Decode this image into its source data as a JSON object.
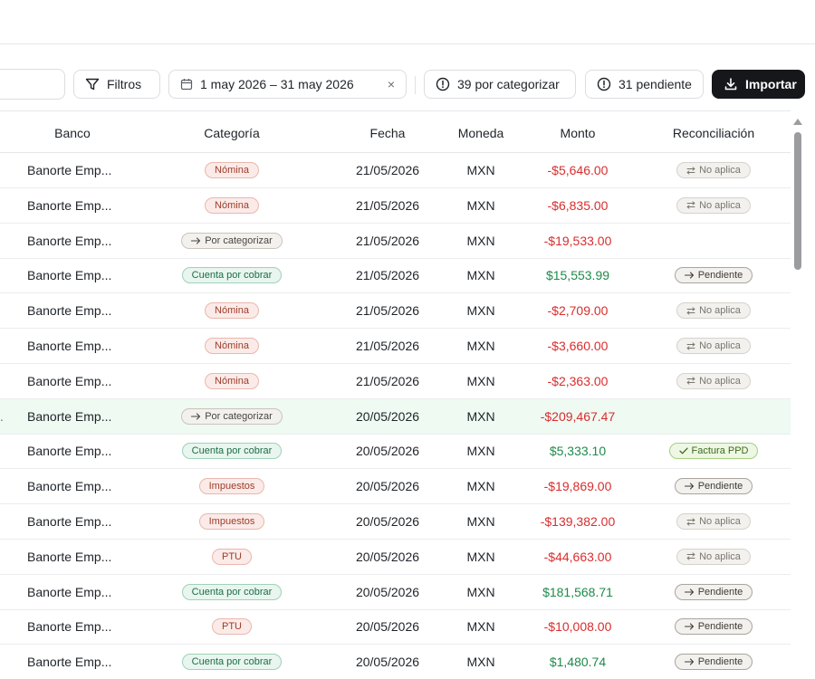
{
  "toolbar": {
    "filters_label": "Filtros",
    "date_range_label": "1 may 2026 – 31 may 2026",
    "clear_label": "×",
    "uncategorized_label": "39 por categorizar",
    "pending_label": "31 pendiente",
    "import_label": "Importar"
  },
  "table": {
    "headers": {
      "banco": "Banco",
      "categoria": "Categoría",
      "fecha": "Fecha",
      "moneda": "Moneda",
      "monto": "Monto",
      "reconciliacion": "Reconciliación"
    },
    "rows": [
      {
        "lead": "",
        "banco": "Banorte Emp...",
        "categoria": "Nómina",
        "cat_type": "nomina",
        "fecha": "21/05/2026",
        "moneda": "MXN",
        "monto": "-$5,646.00",
        "sign": "neg",
        "rec": "No aplica",
        "rec_type": "na"
      },
      {
        "lead": "",
        "banco": "Banorte Emp...",
        "categoria": "Nómina",
        "cat_type": "nomina",
        "fecha": "21/05/2026",
        "moneda": "MXN",
        "monto": "-$6,835.00",
        "sign": "neg",
        "rec": "No aplica",
        "rec_type": "na"
      },
      {
        "lead": "",
        "banco": "Banorte Emp...",
        "categoria": "Por categorizar",
        "cat_type": "cat",
        "fecha": "21/05/2026",
        "moneda": "MXN",
        "monto": "-$19,533.00",
        "sign": "neg",
        "rec": "",
        "rec_type": ""
      },
      {
        "lead": "",
        "banco": "Banorte Emp...",
        "categoria": "Cuenta por cobrar",
        "cat_type": "cxc",
        "fecha": "21/05/2026",
        "moneda": "MXN",
        "monto": "$15,553.99",
        "sign": "pos",
        "rec": "Pendiente",
        "rec_type": "pend"
      },
      {
        "lead": "",
        "banco": "Banorte Emp...",
        "categoria": "Nómina",
        "cat_type": "nomina",
        "fecha": "21/05/2026",
        "moneda": "MXN",
        "monto": "-$2,709.00",
        "sign": "neg",
        "rec": "No aplica",
        "rec_type": "na"
      },
      {
        "lead": "",
        "banco": "Banorte Emp...",
        "categoria": "Nómina",
        "cat_type": "nomina",
        "fecha": "21/05/2026",
        "moneda": "MXN",
        "monto": "-$3,660.00",
        "sign": "neg",
        "rec": "No aplica",
        "rec_type": "na"
      },
      {
        "lead": "",
        "banco": "Banorte Emp...",
        "categoria": "Nómina",
        "cat_type": "nomina",
        "fecha": "21/05/2026",
        "moneda": "MXN",
        "monto": "-$2,363.00",
        "sign": "neg",
        "rec": "No aplica",
        "rec_type": "na"
      },
      {
        "lead": ".",
        "banco": "Banorte Emp...",
        "categoria": "Por categorizar",
        "cat_type": "cat",
        "fecha": "20/05/2026",
        "moneda": "MXN",
        "monto": "-$209,467.47",
        "sign": "neg",
        "rec": "",
        "rec_type": "",
        "highlight": true
      },
      {
        "lead": "",
        "banco": "Banorte Emp...",
        "categoria": "Cuenta por cobrar",
        "cat_type": "cxc",
        "fecha": "20/05/2026",
        "moneda": "MXN",
        "monto": "$5,333.10",
        "sign": "pos",
        "rec": "Factura PPD",
        "rec_type": "ppd"
      },
      {
        "lead": "",
        "banco": "Banorte Emp...",
        "categoria": "Impuestos",
        "cat_type": "imp",
        "fecha": "20/05/2026",
        "moneda": "MXN",
        "monto": "-$19,869.00",
        "sign": "neg",
        "rec": "Pendiente",
        "rec_type": "pend"
      },
      {
        "lead": "",
        "banco": "Banorte Emp...",
        "categoria": "Impuestos",
        "cat_type": "imp",
        "fecha": "20/05/2026",
        "moneda": "MXN",
        "monto": "-$139,382.00",
        "sign": "neg",
        "rec": "No aplica",
        "rec_type": "na"
      },
      {
        "lead": "",
        "banco": "Banorte Emp...",
        "categoria": "PTU",
        "cat_type": "ptu",
        "fecha": "20/05/2026",
        "moneda": "MXN",
        "monto": "-$44,663.00",
        "sign": "neg",
        "rec": "No aplica",
        "rec_type": "na"
      },
      {
        "lead": "",
        "banco": "Banorte Emp...",
        "categoria": "Cuenta por cobrar",
        "cat_type": "cxc",
        "fecha": "20/05/2026",
        "moneda": "MXN",
        "monto": "$181,568.71",
        "sign": "pos",
        "rec": "Pendiente",
        "rec_type": "pend"
      },
      {
        "lead": "",
        "banco": "Banorte Emp...",
        "categoria": "PTU",
        "cat_type": "ptu",
        "fecha": "20/05/2026",
        "moneda": "MXN",
        "monto": "-$10,008.00",
        "sign": "neg",
        "rec": "Pendiente",
        "rec_type": "pend"
      },
      {
        "lead": "",
        "banco": "Banorte Emp...",
        "categoria": "Cuenta por cobrar",
        "cat_type": "cxc",
        "fecha": "20/05/2026",
        "moneda": "MXN",
        "monto": "$1,480.74",
        "sign": "pos",
        "rec": "Pendiente",
        "rec_type": "pend"
      }
    ]
  },
  "colors": {
    "negative": "#d92d2d",
    "positive": "#1e8a4a",
    "primary_button": "#16171a",
    "row_highlight": "#eefaf2"
  }
}
